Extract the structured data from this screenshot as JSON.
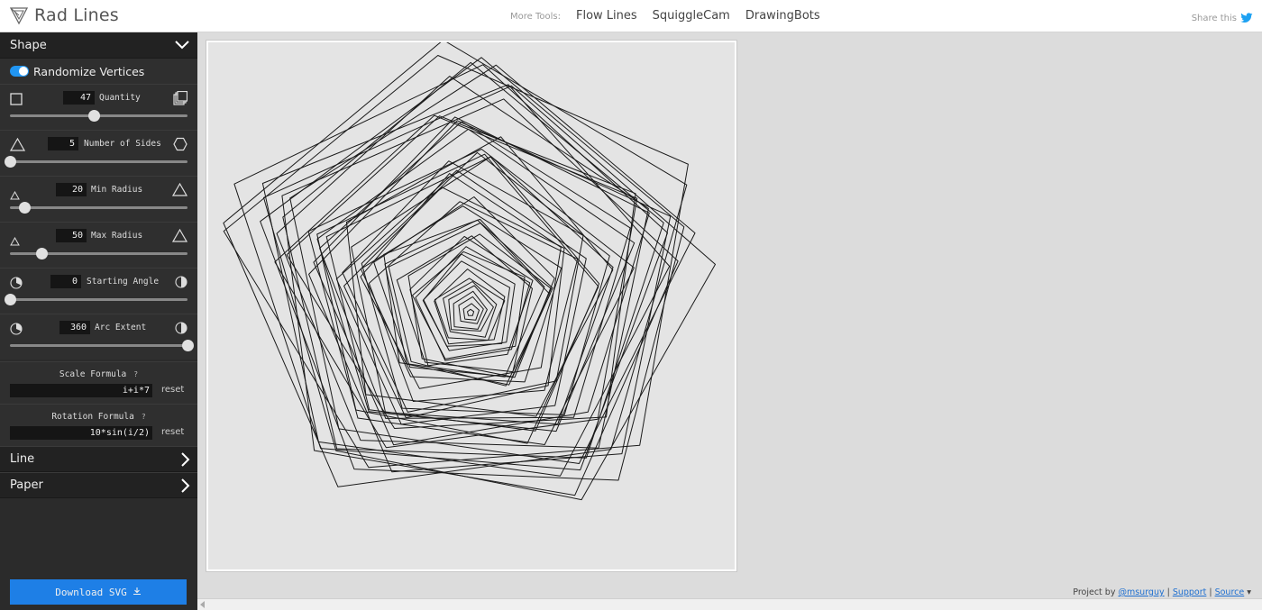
{
  "app": {
    "title": "Rad Lines"
  },
  "nav": {
    "more_label": "More Tools:",
    "links": [
      "Flow Lines",
      "SquiggleCam",
      "DrawingBots"
    ]
  },
  "share": {
    "label": "Share this",
    "icon": "twitter-icon"
  },
  "sidebar": {
    "shape_section": "Shape",
    "randomize_label": "Randomize Vertices",
    "randomize_on": true,
    "params": [
      {
        "label": "Quantity",
        "value": "47",
        "level": 0.47
      },
      {
        "label": "Number of Sides",
        "value": "5",
        "level": 0.0
      },
      {
        "label": "Min Radius",
        "value": "20",
        "level": 0.08
      },
      {
        "label": "Max Radius",
        "value": "50",
        "level": 0.18
      },
      {
        "label": "Starting Angle",
        "value": "0",
        "level": 0.0
      },
      {
        "label": "Arc Extent",
        "value": "360",
        "level": 1.0
      }
    ],
    "scale_formula": {
      "label": "Scale Formula",
      "help": "?",
      "value": "i+i*7",
      "reset": "reset"
    },
    "rotation_formula": {
      "label": "Rotation Formula",
      "help": "?",
      "value": "10*sin(i/2)",
      "reset": "reset"
    },
    "line_section": "Line",
    "paper_section": "Paper",
    "download_label": "Download SVG"
  },
  "footer": {
    "prefix": "Project by",
    "author": "@msurguy",
    "support": "Support",
    "source": "Source",
    "sep": "|"
  },
  "colors": {
    "accent": "#1e7fe6",
    "sidebar": "#2b2b2b",
    "toggle": "#2196f3"
  }
}
